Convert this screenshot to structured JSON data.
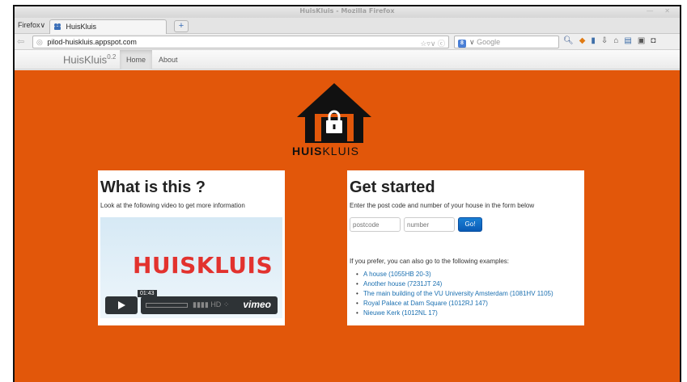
{
  "window": {
    "title": "HuisKluis - Mozilla Firefox",
    "controls": "— ✕"
  },
  "browser": {
    "app_menu": "Firefox∨",
    "tab_label": "HuisKluis",
    "tab_close": "",
    "new_tab": "+",
    "url": "pilod-huiskluis.appspot.com",
    "search_placeholder": "Google",
    "search_engine_icon": "google-icon",
    "toolbar_icons": [
      "search-icon",
      "addon-icon",
      "lock-icon",
      "download-icon",
      "home-icon",
      "bookmark-icon",
      "window-icon",
      "pocket-icon"
    ]
  },
  "nav": {
    "brand": "HuisKluis",
    "version": "0.2",
    "links": [
      {
        "label": "Home",
        "active": true
      },
      {
        "label": "About",
        "active": false
      }
    ]
  },
  "logo": {
    "text_bold": "HUIS",
    "text_light": "KLUIS",
    "icon": "house-lock-icon"
  },
  "left_panel": {
    "heading": "What is this ?",
    "text": "Look at the following video to get more information",
    "video": {
      "title": "HUISKLUIS",
      "time": "01:43",
      "hd": "HD",
      "provider": "vimeo"
    }
  },
  "right_panel": {
    "heading": "Get started",
    "text": "Enter the post code and number of your house in the form below",
    "postcode_placeholder": "postcode",
    "number_placeholder": "number",
    "go_label": "Go!",
    "examples_intro": "If you prefer, you can also go to the following examples:",
    "examples": [
      "A house (1055HB 20-3)",
      "Another house (7231JT 24)",
      "The main building of the VU University Amsterdam (1081HV 1105)",
      "Royal Palace at Dam Square (1012RJ 147)",
      "Nieuwe Kerk (1012NL 17)"
    ]
  },
  "colors": {
    "page_background": "#e2570a",
    "link": "#1a6fb0",
    "go_button": "#0a5bb5",
    "video_title": "#e2322e"
  }
}
